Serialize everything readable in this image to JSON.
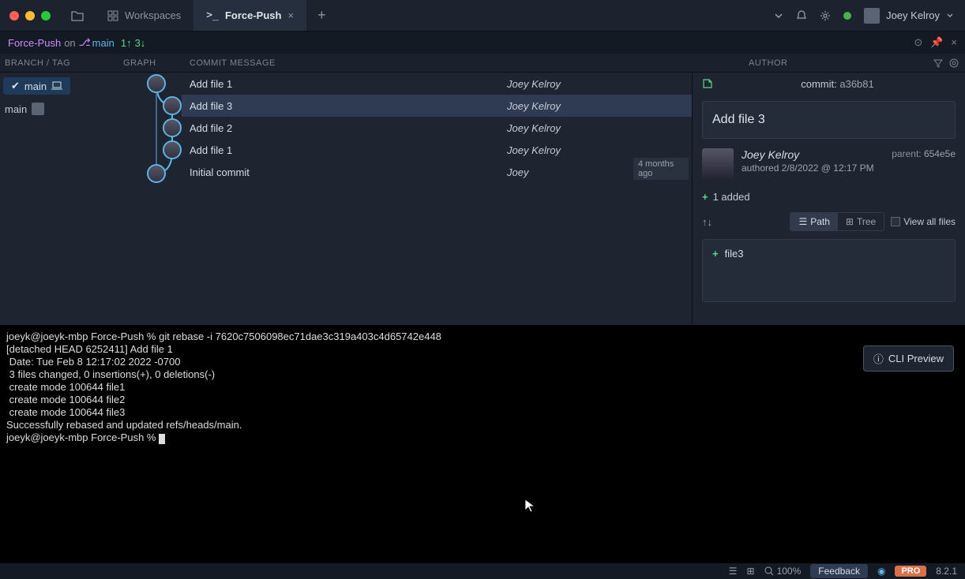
{
  "titlebar": {
    "workspaces_label": "Workspaces",
    "active_tab": "Force-Push",
    "user_name": "Joey Kelroy"
  },
  "repobar": {
    "repo": "Force-Push",
    "on": "on",
    "branch": "main",
    "ahead": "1↑",
    "behind": "3↓"
  },
  "headers": {
    "branch": "BRANCH / TAG",
    "graph": "GRAPH",
    "message": "COMMIT MESSAGE",
    "author": "AUTHOR"
  },
  "branches": {
    "remote": "main",
    "local": "main"
  },
  "commits": [
    {
      "msg": "Add file 1",
      "author": "Joey Kelroy"
    },
    {
      "msg": "Add file 3",
      "author": "Joey Kelroy"
    },
    {
      "msg": "Add file 2",
      "author": "Joey Kelroy"
    },
    {
      "msg": "Add file 1",
      "author": "Joey Kelroy"
    },
    {
      "msg": "Initial commit",
      "author": "Joey"
    }
  ],
  "ago_badge": "4 months ago",
  "detail": {
    "commit_lbl": "commit:",
    "hash": "a36b81",
    "message": "Add file 3",
    "author": "Joey Kelroy",
    "authored_lbl": "authored",
    "date": "2/8/2022 @ 12:17 PM",
    "parent_lbl": "parent:",
    "parent_hash": "654e5e",
    "added": "1 added",
    "path_label": "Path",
    "tree_label": "Tree",
    "viewall_label": "View all files",
    "file": "file3"
  },
  "terminal": {
    "lines": "joeyk@joeyk-mbp Force-Push % git rebase -i 7620c7506098ec71dae3c319a403c4d65742e448\n[detached HEAD 6252411] Add file 1\n Date: Tue Feb 8 12:17:02 2022 -0700\n 3 files changed, 0 insertions(+), 0 deletions(-)\n create mode 100644 file1\n create mode 100644 file2\n create mode 100644 file3\nSuccessfully rebased and updated refs/heads/main.\njoeyk@joeyk-mbp Force-Push % "
  },
  "cli_preview": "CLI Preview",
  "statusbar": {
    "zoom": "100%",
    "feedback": "Feedback",
    "pro": "PRO",
    "version": "8.2.1"
  }
}
